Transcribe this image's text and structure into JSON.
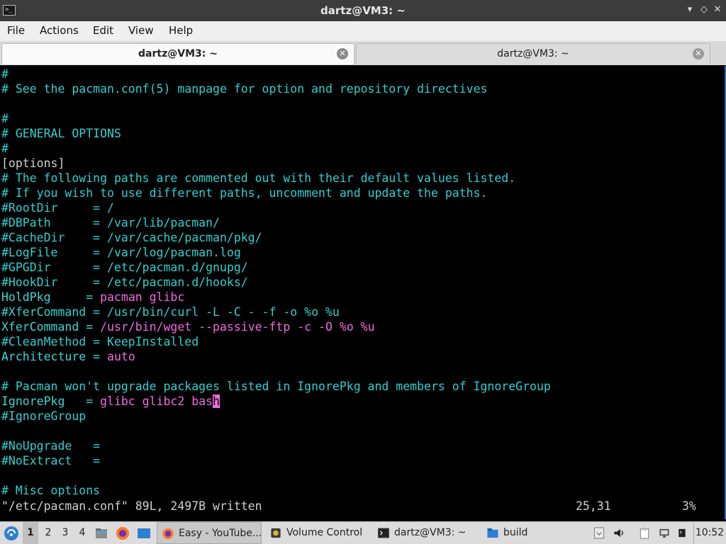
{
  "window": {
    "title": "dartz@VM3: ~",
    "controls": {
      "minimize": "▾",
      "maximize": "◇",
      "close": "✕"
    }
  },
  "menu": [
    "File",
    "Actions",
    "Edit",
    "View",
    "Help"
  ],
  "tabs": [
    {
      "label": "dartz@VM3: ~",
      "active": true
    },
    {
      "label": "dartz@VM3: ~",
      "active": false
    }
  ],
  "terminal": {
    "lines": [
      [
        {
          "t": "#",
          "c": "cmt"
        }
      ],
      [
        {
          "t": "# See the pacman.conf(5) manpage for option and repository directives",
          "c": "cmt"
        }
      ],
      [],
      [
        {
          "t": "#",
          "c": "cmt"
        }
      ],
      [
        {
          "t": "# GENERAL OPTIONS",
          "c": "cmt"
        }
      ],
      [
        {
          "t": "#",
          "c": "cmt"
        }
      ],
      [
        {
          "t": "[options]",
          "c": "plain"
        }
      ],
      [
        {
          "t": "# The following paths are commented out with their default values listed.",
          "c": "cmt"
        }
      ],
      [
        {
          "t": "# If you wish to use different paths, uncomment and update the paths.",
          "c": "cmt"
        }
      ],
      [
        {
          "t": "#RootDir     = /",
          "c": "cmt"
        }
      ],
      [
        {
          "t": "#DBPath      = /var/lib/pacman/",
          "c": "cmt"
        }
      ],
      [
        {
          "t": "#CacheDir    = /var/cache/pacman/pkg/",
          "c": "cmt"
        }
      ],
      [
        {
          "t": "#LogFile     = /var/log/pacman.log",
          "c": "cmt"
        }
      ],
      [
        {
          "t": "#GPGDir      = /etc/pacman.d/gnupg/",
          "c": "cmt"
        }
      ],
      [
        {
          "t": "#HookDir     = /etc/pacman.d/hooks/",
          "c": "cmt"
        }
      ],
      [
        {
          "t": "HoldPkg     = ",
          "c": "key"
        },
        {
          "t": "pacman glibc",
          "c": "val"
        }
      ],
      [
        {
          "t": "#XferCommand = /usr/bin/curl -L -C - -f -o %o %u",
          "c": "cmt"
        }
      ],
      [
        {
          "t": "XferCommand = ",
          "c": "key"
        },
        {
          "t": "/usr/bin/wget --passive-ftp -c -O %o %u",
          "c": "val"
        }
      ],
      [
        {
          "t": "#CleanMethod = KeepInstalled",
          "c": "cmt"
        }
      ],
      [
        {
          "t": "Architecture = ",
          "c": "key"
        },
        {
          "t": "auto",
          "c": "val"
        }
      ],
      [],
      [
        {
          "t": "# Pacman won't upgrade packages listed in IgnorePkg and members of IgnoreGroup",
          "c": "cmt"
        }
      ],
      [
        {
          "t": "IgnorePkg   = ",
          "c": "key"
        },
        {
          "t": "glibc glibc2 bas",
          "c": "val"
        },
        {
          "t": "h",
          "c": "cursor"
        }
      ],
      [
        {
          "t": "#IgnoreGroup",
          "c": "cmt"
        }
      ],
      [],
      [
        {
          "t": "#NoUpgrade   =",
          "c": "cmt"
        }
      ],
      [
        {
          "t": "#NoExtract   =",
          "c": "cmt"
        }
      ],
      [],
      [
        {
          "t": "# Misc options",
          "c": "cmt"
        }
      ]
    ],
    "status_left": "\"/etc/pacman.conf\" 89L, 2497B written",
    "status_position": "25,31",
    "status_percent": "3%"
  },
  "taskbar": {
    "workspaces": [
      "1",
      "2",
      "3",
      "4"
    ],
    "tasks": [
      {
        "label": "Easy - YouTube...",
        "icon": "firefox-icon",
        "active": true
      },
      {
        "label": "Volume Control",
        "icon": "volume-control-icon",
        "active": false
      },
      {
        "label": "dartz@VM3: ~",
        "icon": "terminal-icon",
        "active": false
      },
      {
        "label": "build",
        "icon": "folder-icon",
        "active": false
      }
    ],
    "clock": "10:52"
  },
  "colors": {
    "comment": "#30d0d0",
    "value": "#f06ae0",
    "accent": "#2f6fb0"
  }
}
